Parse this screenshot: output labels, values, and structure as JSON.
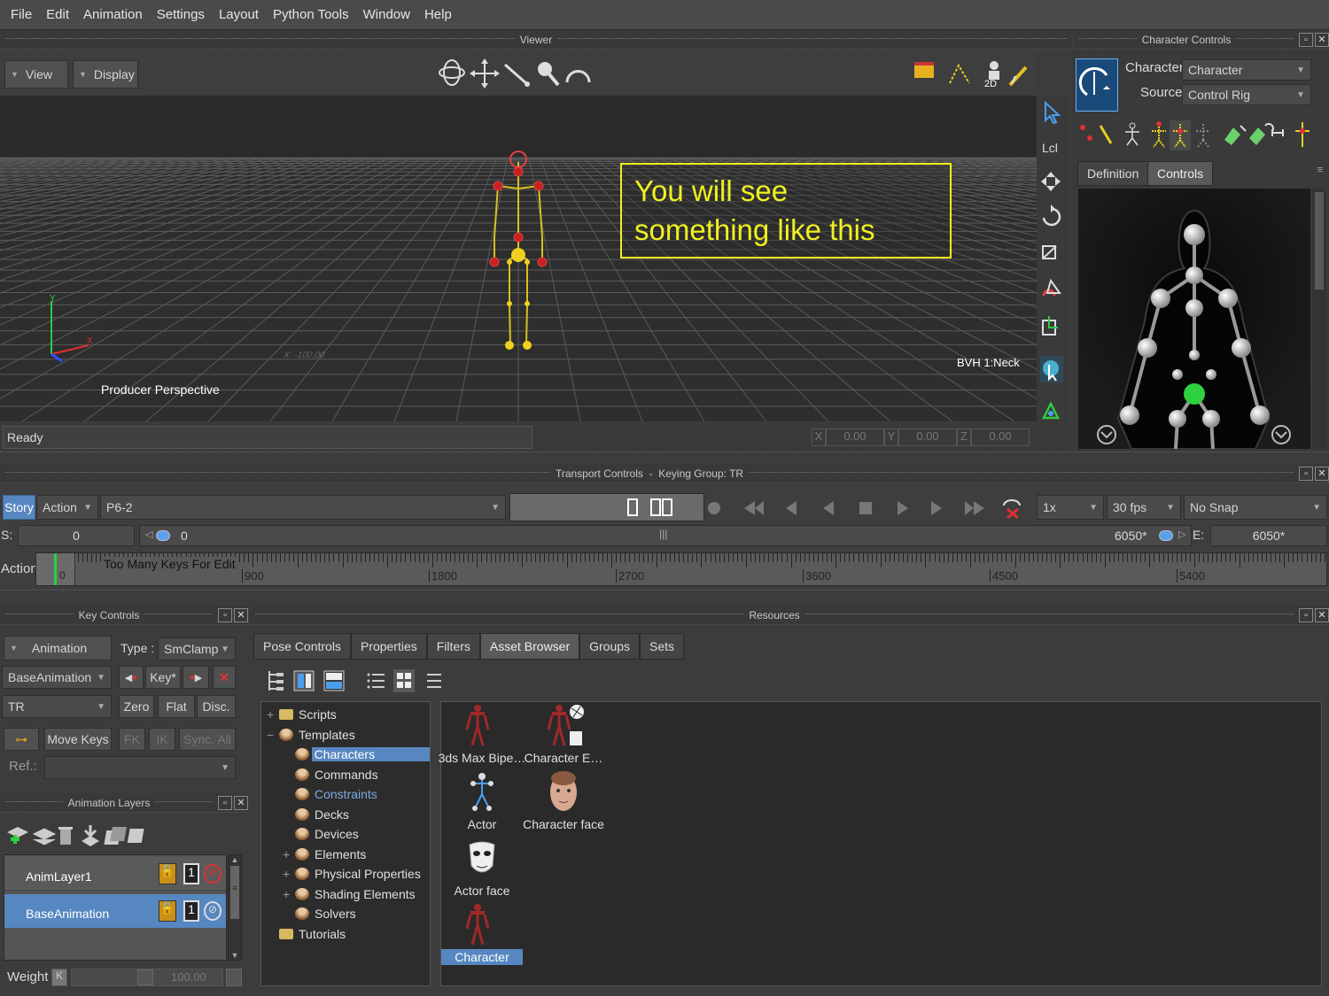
{
  "menu": [
    "File",
    "Edit",
    "Animation",
    "Settings",
    "Layout",
    "Python Tools",
    "Window",
    "Help"
  ],
  "viewer": {
    "title": "Viewer",
    "view_label": "View",
    "display_label": "Display",
    "perspective_label": "Producer Perspective",
    "selected_label": "BVH 1:Neck",
    "status": "Ready",
    "coords": {
      "x_label": "X",
      "x": "0.00",
      "y_label": "Y",
      "y": "0.00",
      "z_label": "Z",
      "z": "0.00"
    },
    "grid_label": "X: -100.00"
  },
  "annotation": {
    "line1": "You will see",
    "line2": "something like this",
    "color": "#ffff00"
  },
  "character_controls": {
    "title": "Character Controls",
    "character_label": "Character:",
    "character_value": "Character",
    "source_label": "Source:",
    "source_value": "Control Rig",
    "tabs": [
      "Definition",
      "Controls"
    ],
    "lcl_label": "Lcl"
  },
  "transport": {
    "title": "Transport Controls",
    "keying_group": "Keying Group: TR",
    "separator": "-",
    "story_label": "Story",
    "action_label": "Action",
    "take": "P6-2",
    "speed": "1x",
    "fps": "30 fps",
    "snap": "No Snap",
    "s_label": "S:",
    "start": "0",
    "current": "0",
    "end_time": "6050*",
    "e_label": "E:",
    "end": "6050*",
    "action_row_label": "Action",
    "action_zero": "0",
    "too_many": "Too Many Keys For Edit",
    "ticks": [
      "900",
      "1800",
      "2700",
      "3600",
      "4500",
      "5400"
    ]
  },
  "key_controls": {
    "title": "Key Controls",
    "animation_label": "Animation",
    "type_label": "Type :",
    "type_value": "SmClamp",
    "layer_value": "BaseAnimation",
    "key_label": "Key*",
    "tr_value": "TR",
    "zero": "Zero",
    "flat": "Flat",
    "disc": "Disc.",
    "move_keys": "Move Keys",
    "fk": "FK",
    "ik": "IK",
    "sync_all": "Sync. All",
    "ref_label": "Ref.:"
  },
  "anim_layers": {
    "title": "Animation Layers",
    "layers": [
      {
        "name": "AnimLayer1",
        "num": "1"
      },
      {
        "name": "BaseAnimation",
        "num": "1"
      }
    ],
    "weight_label": "Weight",
    "k_label": "K",
    "weight_value": "100.00"
  },
  "resources": {
    "title": "Resources",
    "tabs": [
      "Pose Controls",
      "Properties",
      "Filters",
      "Asset Browser",
      "Groups",
      "Sets"
    ],
    "active_tab": "Asset Browser",
    "tree": [
      {
        "label": "Scripts",
        "level": 0,
        "exp": "+",
        "type": "folder"
      },
      {
        "label": "Templates",
        "level": 0,
        "exp": "−",
        "type": "tmpl"
      },
      {
        "label": "Characters",
        "level": 1,
        "exp": "",
        "type": "tmpl",
        "selected": true
      },
      {
        "label": "Commands",
        "level": 1,
        "exp": "",
        "type": "tmpl"
      },
      {
        "label": "Constraints",
        "level": 1,
        "exp": "",
        "type": "tmpl",
        "blue": true
      },
      {
        "label": "Decks",
        "level": 1,
        "exp": "",
        "type": "tmpl"
      },
      {
        "label": "Devices",
        "level": 1,
        "exp": "",
        "type": "tmpl"
      },
      {
        "label": "Elements",
        "level": 1,
        "exp": "+",
        "type": "tmpl"
      },
      {
        "label": "Physical Properties",
        "level": 1,
        "exp": "+",
        "type": "tmpl"
      },
      {
        "label": "Shading Elements",
        "level": 1,
        "exp": "+",
        "type": "tmpl"
      },
      {
        "label": "Solvers",
        "level": 1,
        "exp": "",
        "type": "tmpl"
      },
      {
        "label": "Tutorials",
        "level": 0,
        "exp": "",
        "type": "folder"
      }
    ],
    "assets": [
      {
        "label": "3ds Max Bipe…",
        "icon": "figure"
      },
      {
        "label": "Character E…",
        "icon": "figure-ext"
      },
      {
        "label": "Actor",
        "icon": "actor"
      },
      {
        "label": "Character face",
        "icon": "face"
      },
      {
        "label": "Actor face",
        "icon": "mask"
      },
      {
        "label": "Character",
        "icon": "figure",
        "selected": true
      }
    ]
  }
}
